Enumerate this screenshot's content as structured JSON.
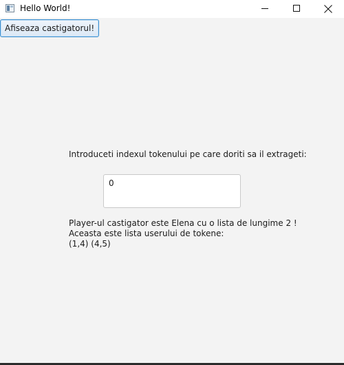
{
  "window": {
    "title": "Hello World!",
    "controls": {
      "minimize_icon": "minimize-icon",
      "maximize_icon": "maximize-icon",
      "close_icon": "close-icon"
    }
  },
  "toolbar": {
    "winner_button_label": "Afiseaza castigatorul!"
  },
  "main": {
    "prompt_label": "Introduceti indexul tokenului pe care doriti sa il extrageti:",
    "token_index_value": "0",
    "result_lines": [
      "Player-ul castigator este Elena cu o lista de lungime 2 !",
      "Aceasta este lista userului de tokene:",
      "(1,4) (4,5)"
    ]
  },
  "colors": {
    "background": "#f3f3f3",
    "titlebar": "#ffffff",
    "button_border": "#3c8fd0",
    "input_border": "#c9c9c9"
  }
}
